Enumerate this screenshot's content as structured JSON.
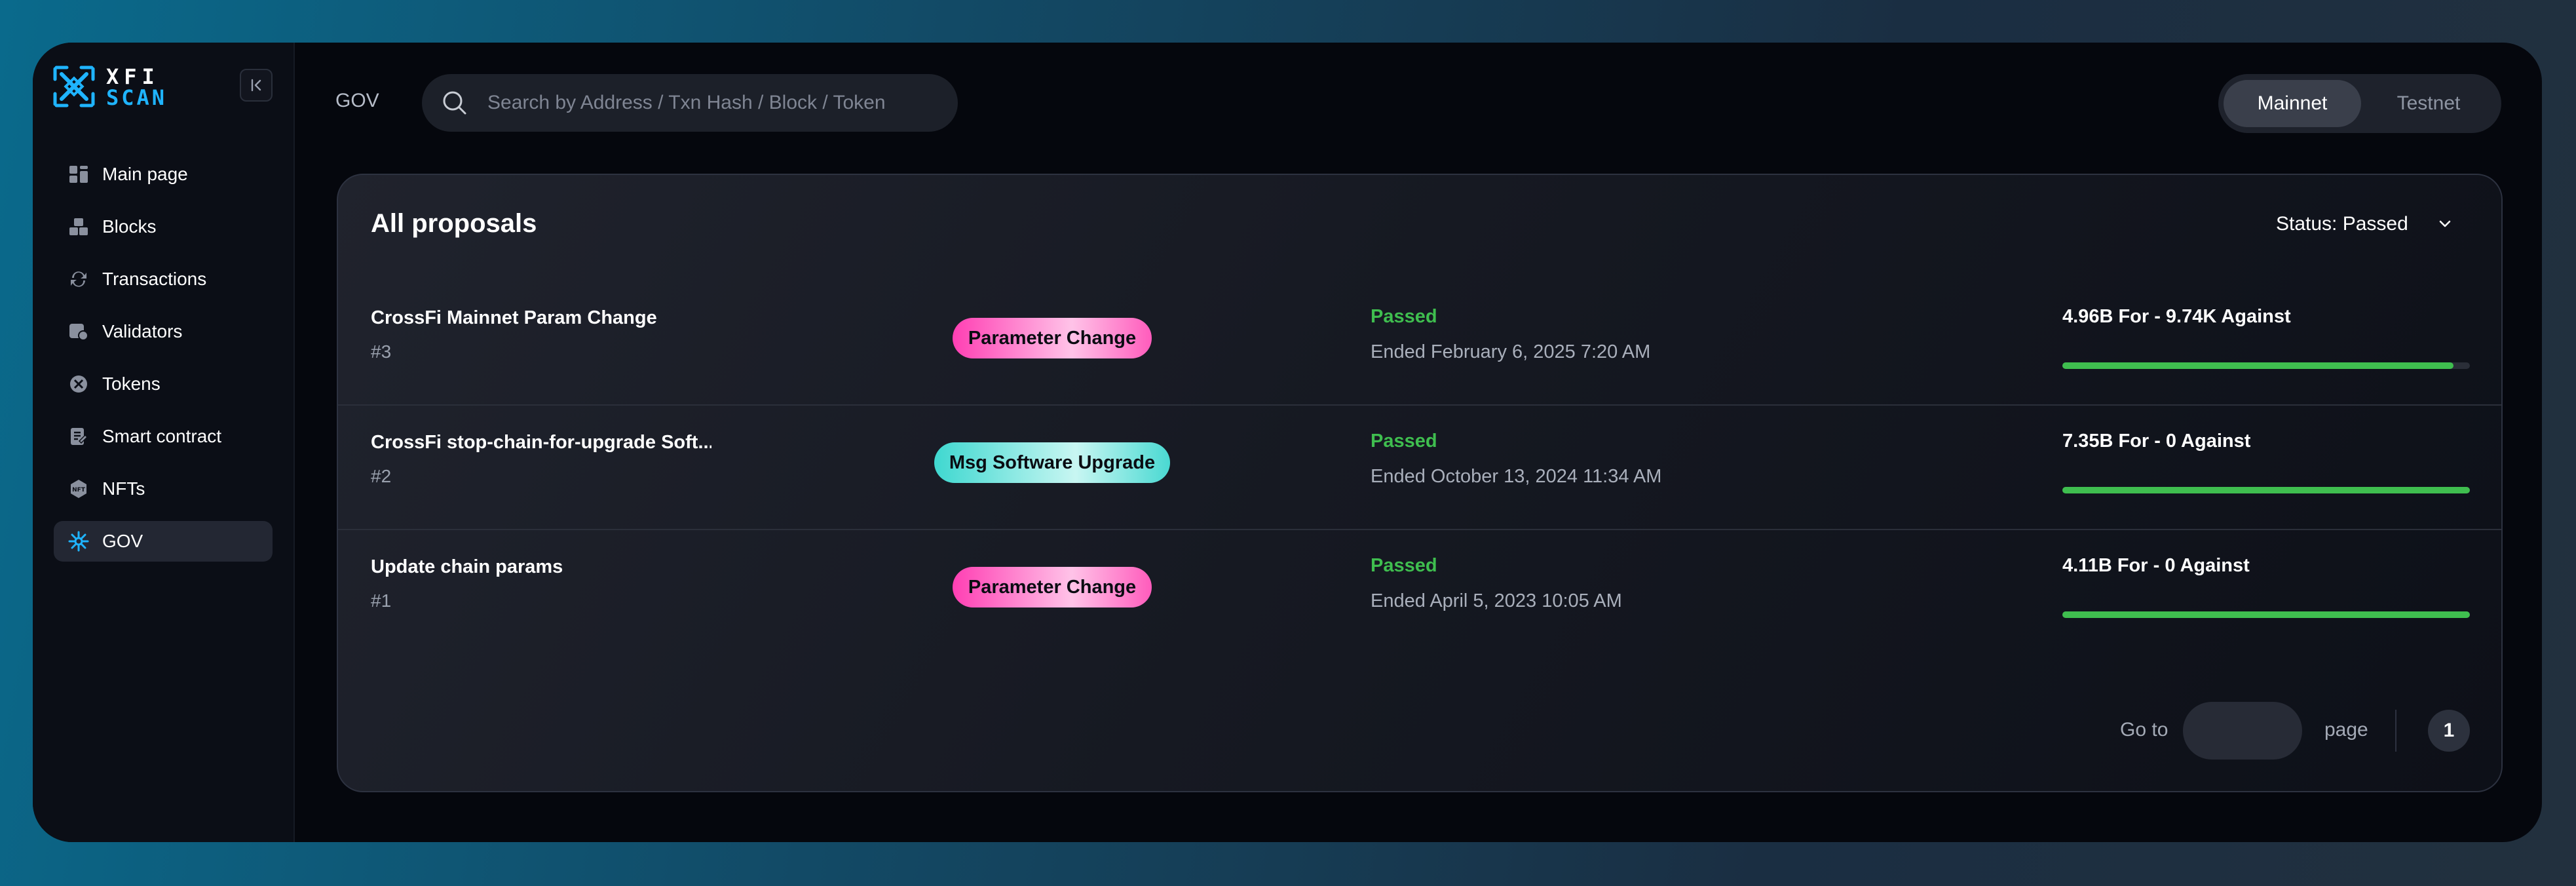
{
  "brand": {
    "line1": "XFI",
    "line2": "SCAN"
  },
  "sidebar": {
    "items": [
      {
        "label": "Main page",
        "icon": "grid-icon"
      },
      {
        "label": "Blocks",
        "icon": "blocks-icon"
      },
      {
        "label": "Transactions",
        "icon": "transactions-icon"
      },
      {
        "label": "Validators",
        "icon": "validators-icon"
      },
      {
        "label": "Tokens",
        "icon": "token-icon"
      },
      {
        "label": "Smart contract",
        "icon": "contract-icon"
      },
      {
        "label": "NFTs",
        "icon": "nft-icon"
      },
      {
        "label": "GOV",
        "icon": "gov-icon",
        "active": true
      }
    ]
  },
  "header": {
    "breadcrumb": "GOV",
    "search_placeholder": "Search by Address / Txn Hash / Block / Token",
    "networks": [
      "Mainnet",
      "Testnet"
    ],
    "selected_network": "Mainnet"
  },
  "panel": {
    "title": "All proposals",
    "status_filter": "Status: Passed",
    "proposals": [
      {
        "title": "CrossFi Mainnet Param Change",
        "id": "#3",
        "type": "Parameter Change",
        "status": "Passed",
        "ended": "Ended February 6, 2025 7:20 AM",
        "votes": "4.96B For - 9.74K Against",
        "for_ratio": 0.96
      },
      {
        "title": "CrossFi stop-chain-for-upgrade Soft...",
        "id": "#2",
        "type": "Msg Software Upgrade",
        "status": "Passed",
        "ended": "Ended October 13, 2024 11:34 AM",
        "votes": "7.35B For - 0 Against",
        "for_ratio": 1
      },
      {
        "title": "Update chain params",
        "id": "#1",
        "type": "Parameter Change",
        "status": "Passed",
        "ended": "Ended April 5, 2023 10:05 AM",
        "votes": "4.11B For - 0 Against",
        "for_ratio": 1
      }
    ],
    "pagination": {
      "goto_label": "Go to",
      "page_label": "page",
      "goto_value": "",
      "current_page": "1"
    }
  },
  "colors": {
    "accent": "#1fb4ff",
    "passed": "#3fbe4f",
    "badge_pink": "#ff3fb3",
    "badge_teal": "#3fd8d0"
  }
}
